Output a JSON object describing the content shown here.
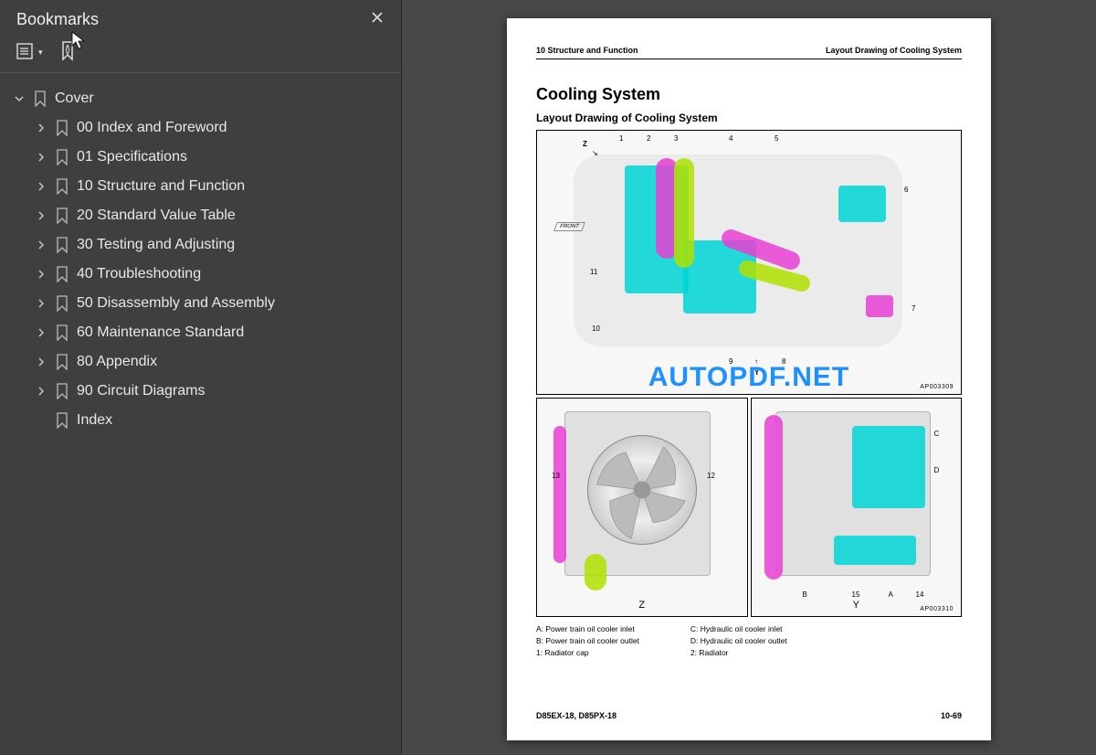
{
  "sidebar": {
    "title": "Bookmarks",
    "root": {
      "label": "Cover"
    },
    "items": [
      {
        "label": "00 Index and Foreword"
      },
      {
        "label": "01 Specifications"
      },
      {
        "label": "10 Structure and Function"
      },
      {
        "label": "20 Standard Value Table"
      },
      {
        "label": "30 Testing and Adjusting"
      },
      {
        "label": "40 Troubleshooting"
      },
      {
        "label": "50 Disassembly and Assembly"
      },
      {
        "label": "60 Maintenance Standard"
      },
      {
        "label": "80 Appendix"
      },
      {
        "label": "90 Circuit Diagrams"
      }
    ],
    "last_item": {
      "label": "Index"
    }
  },
  "watermark": "AUTOPDF.NET",
  "page": {
    "header_left": "10 Structure and Function",
    "header_right": "Layout Drawing of Cooling System",
    "h1": "Cooling System",
    "h2": "Layout Drawing of Cooling System",
    "fig1": {
      "code": "AP003309",
      "z_label": "Z",
      "y_label": "Y",
      "front_label": "FRONT",
      "nums": [
        "1",
        "2",
        "3",
        "4",
        "5",
        "6",
        "7",
        "8",
        "9",
        "10",
        "11"
      ]
    },
    "fig2a": {
      "view": "Z",
      "n12": "12",
      "n13": "13"
    },
    "fig2b": {
      "view": "Y",
      "code": "AP003310",
      "lA": "A",
      "lB": "B",
      "lC": "C",
      "lD": "D",
      "n14": "14",
      "n15": "15"
    },
    "legend": {
      "left": [
        "A: Power train oil cooler inlet",
        "B: Power train oil cooler outlet",
        "1: Radiator cap"
      ],
      "right": [
        "C: Hydraulic oil cooler inlet",
        "D: Hydraulic oil cooler outlet",
        "2: Radiator"
      ]
    },
    "footer_left": "D85EX-18, D85PX-18",
    "footer_right": "10-69"
  }
}
